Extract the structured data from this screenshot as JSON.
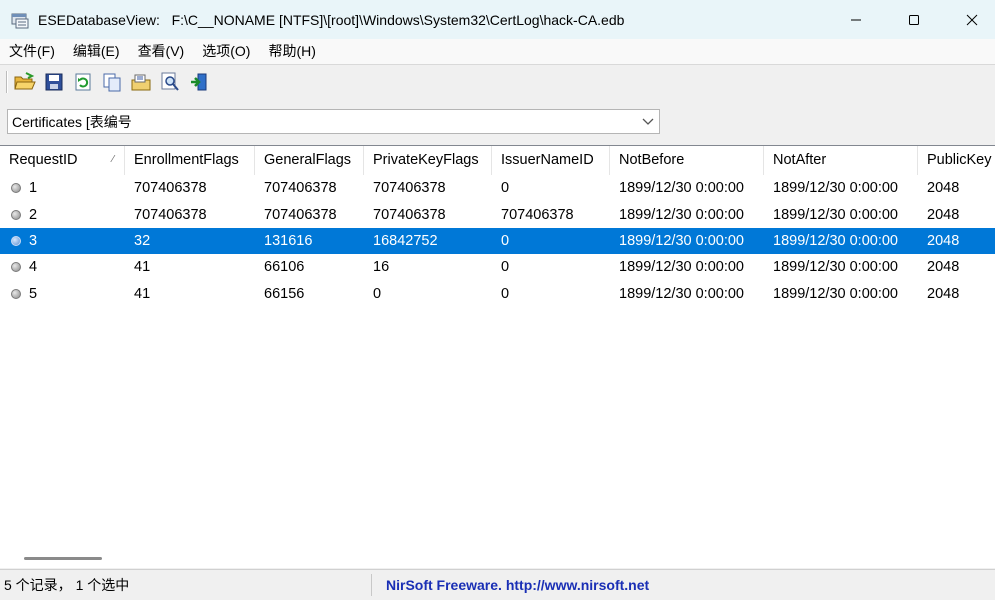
{
  "window": {
    "title": "ESEDatabaseView:   F:\\C__NONAME [NTFS]\\[root]\\Windows\\System32\\CertLog\\hack-CA.edb"
  },
  "menu": [
    {
      "label": "文件(F)"
    },
    {
      "label": "编辑(E)"
    },
    {
      "label": "查看(V)"
    },
    {
      "label": "选项(O)"
    },
    {
      "label": "帮助(H)"
    }
  ],
  "toolbar": {
    "icons": [
      "open-folder-icon",
      "save-icon",
      "refresh-icon",
      "copy-icon",
      "properties-icon",
      "find-icon",
      "exit-icon"
    ]
  },
  "table_selector": {
    "selected": "Certificates   [表编号"
  },
  "columns": [
    {
      "label": "RequestID",
      "sort_indicator": "⁄"
    },
    {
      "label": "EnrollmentFlags"
    },
    {
      "label": "GeneralFlags"
    },
    {
      "label": "PrivateKeyFlags"
    },
    {
      "label": "IssuerNameID"
    },
    {
      "label": "NotBefore"
    },
    {
      "label": "NotAfter"
    },
    {
      "label": "PublicKey"
    }
  ],
  "rows": [
    {
      "cells": [
        "1",
        "707406378",
        "707406378",
        "707406378",
        "0",
        "1899/12/30 0:00:00",
        "1899/12/30 0:00:00",
        "2048"
      ],
      "selected": false
    },
    {
      "cells": [
        "2",
        "707406378",
        "707406378",
        "707406378",
        "707406378",
        "1899/12/30 0:00:00",
        "1899/12/30 0:00:00",
        "2048"
      ],
      "selected": false
    },
    {
      "cells": [
        "3",
        "32",
        "131616",
        "16842752",
        "0",
        "1899/12/30 0:00:00",
        "1899/12/30 0:00:00",
        "2048"
      ],
      "selected": true
    },
    {
      "cells": [
        "4",
        "41",
        "66106",
        "16",
        "0",
        "1899/12/30 0:00:00",
        "1899/12/30 0:00:00",
        "2048"
      ],
      "selected": false
    },
    {
      "cells": [
        "5",
        "41",
        "66156",
        "0",
        "0",
        "1899/12/30 0:00:00",
        "1899/12/30 0:00:00",
        "2048"
      ],
      "selected": false
    }
  ],
  "status": {
    "records": "5 个记录， 1 个选中",
    "credit": "NirSoft Freeware.  http://www.nirsoft.net"
  },
  "colors": {
    "selection": "#0078d7",
    "titlebar": "#e9f5f9",
    "link": "#1a2fb5"
  }
}
